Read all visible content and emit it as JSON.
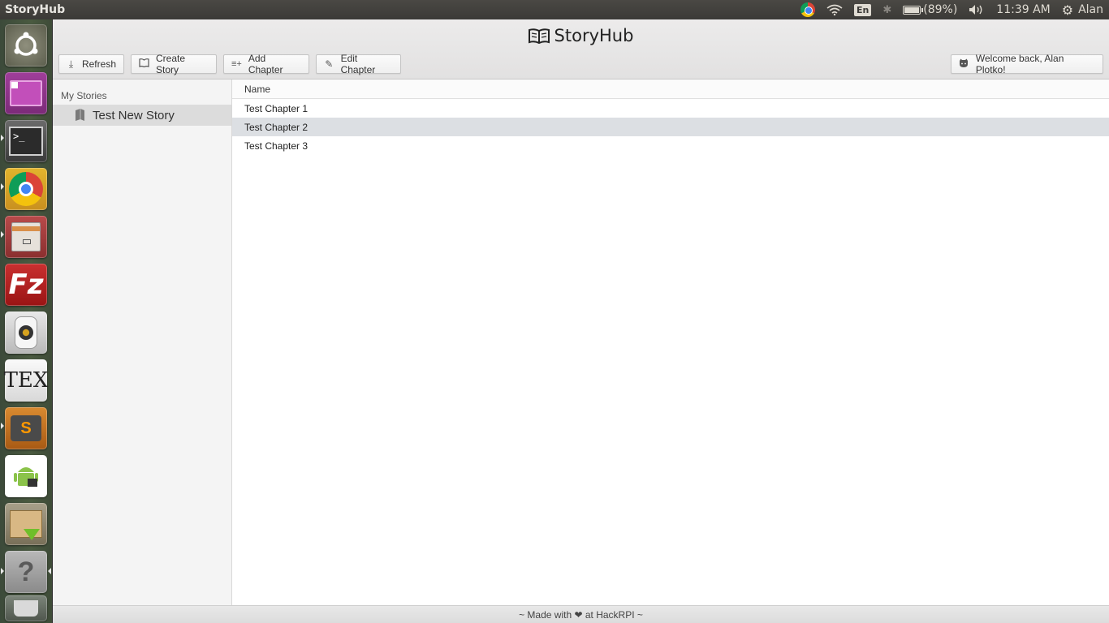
{
  "system": {
    "app_title": "StoryHub",
    "keyboard_layout": "En",
    "battery": "(89%)",
    "clock": "11:39 AM",
    "user": "Alan"
  },
  "launcher": {
    "items": [
      "dash-home",
      "workspace-switcher",
      "terminal",
      "chrome",
      "file-cabinet",
      "filezilla",
      "speaker",
      "texmaker",
      "sublime-text",
      "android-sdk",
      "archive-download",
      "help",
      "trash"
    ]
  },
  "header": {
    "brand": "StoryHub",
    "buttons": {
      "refresh": "Refresh",
      "create_story": "Create Story",
      "add_chapter": "Add Chapter",
      "edit_chapter": "Edit Chapter",
      "welcome": "Welcome back, Alan Plotko!"
    }
  },
  "sidebar": {
    "heading": "My Stories",
    "stories": [
      {
        "label": "Test New Story"
      }
    ]
  },
  "chapters": {
    "column": "Name",
    "rows": [
      {
        "name": "Test Chapter 1",
        "selected": false
      },
      {
        "name": "Test Chapter 2",
        "selected": true
      },
      {
        "name": "Test Chapter 3",
        "selected": false
      }
    ]
  },
  "footer": {
    "text": "~ Made with ❤ at HackRPI ~"
  }
}
